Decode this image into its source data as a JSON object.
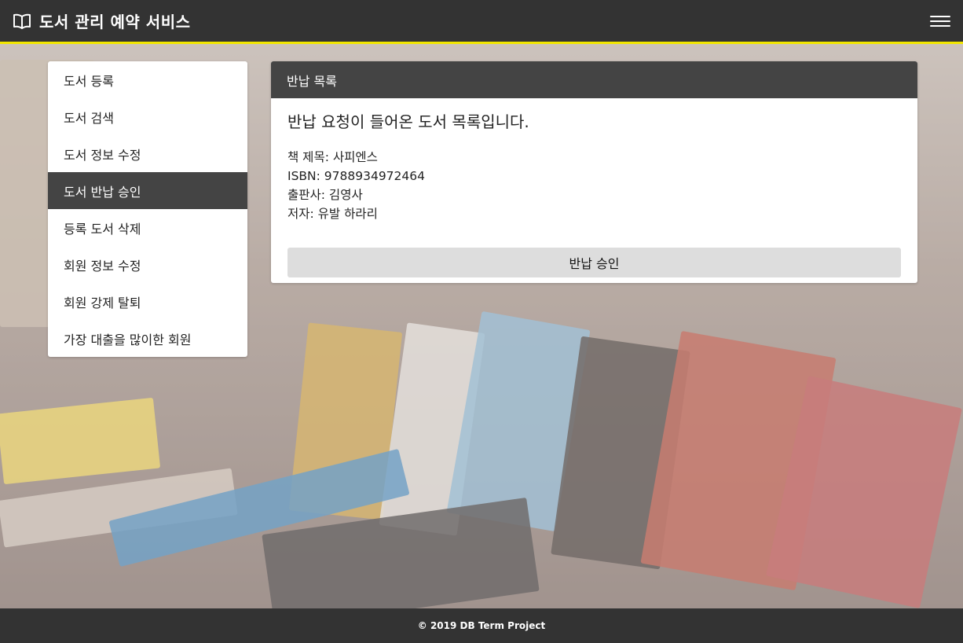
{
  "header": {
    "brand_icon": "open-book-icon",
    "title": "도서 관리 예약 서비스",
    "menu_icon": "hamburger-menu-icon",
    "accent_color": "#f2e600"
  },
  "sidebar": {
    "items": [
      {
        "label": "도서 등록",
        "active": false
      },
      {
        "label": "도서 검색",
        "active": false
      },
      {
        "label": "도서 정보 수정",
        "active": false
      },
      {
        "label": "도서 반납 승인",
        "active": true
      },
      {
        "label": "등록 도서 삭제",
        "active": false
      },
      {
        "label": "회원 정보 수정",
        "active": false
      },
      {
        "label": "회원 강제 탈퇴",
        "active": false
      },
      {
        "label": "가장 대출을 많이한 회원",
        "active": false
      }
    ]
  },
  "panel": {
    "title": "반납 목록",
    "lead": "반납 요청이 들어온 도서 목록입니다.",
    "book": {
      "title_line": "책 제목: 사피엔스",
      "isbn_line": "ISBN: 9788934972464",
      "publisher_line": "출판사: 김영사",
      "author_line": "저자: 유발 하라리"
    },
    "approve_label": "반납 승인"
  },
  "footer": {
    "text": "© 2019 DB Term Project"
  },
  "colors": {
    "bar_background": "#333333",
    "panel_header": "#444444",
    "active_item": "#444444",
    "button_background": "#dddddd"
  }
}
